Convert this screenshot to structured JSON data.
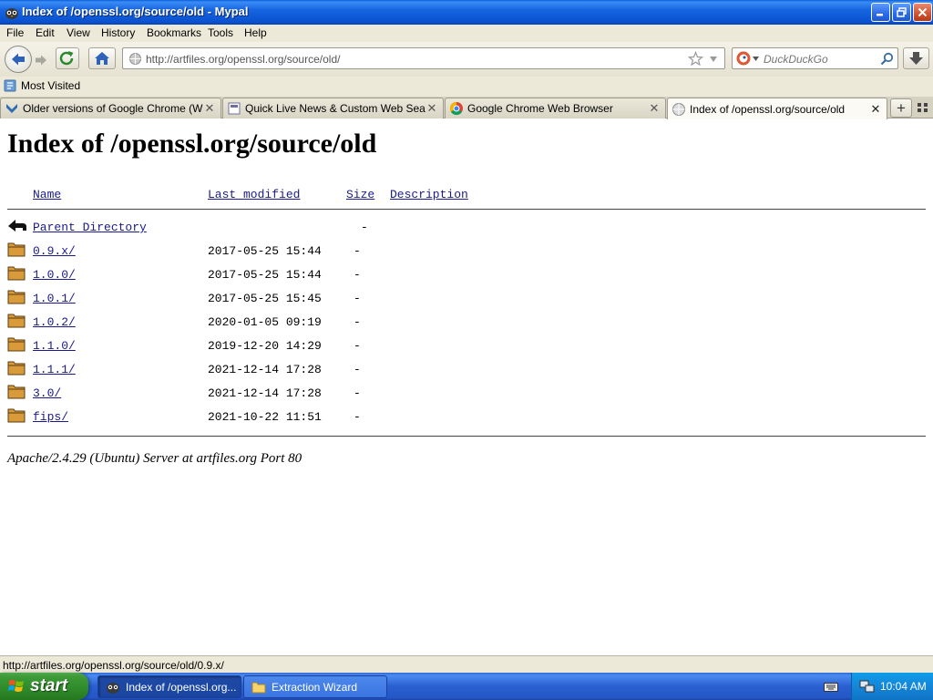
{
  "window": {
    "title": "Index of /openssl.org/source/old - Mypal"
  },
  "menu": {
    "items": [
      "File",
      "Edit",
      "View",
      "History",
      "Bookmarks",
      "Tools",
      "Help"
    ]
  },
  "navbar": {
    "url": "http://artfiles.org/openssl.org/source/old/",
    "search_placeholder": "DuckDuckGo"
  },
  "bookmarks": {
    "most_visited": "Most Visited"
  },
  "tabs": [
    {
      "label": "Older versions of Google Chrome (Wind...",
      "icon": "download-arrow-icon",
      "active": false
    },
    {
      "label": "Quick Live News & Custom Web Search",
      "icon": "page-icon",
      "active": false
    },
    {
      "label": "Google Chrome Web Browser",
      "icon": "chrome-icon",
      "active": false
    },
    {
      "label": "Index of /openssl.org/source/old",
      "icon": "globe-icon",
      "active": true
    }
  ],
  "page": {
    "title": "Index of /openssl.org/source/old",
    "columns": {
      "name": "Name",
      "last_modified": "Last modified",
      "size": "Size",
      "description": "Description"
    },
    "parent": {
      "name": "Parent Directory",
      "size": "-"
    },
    "rows": [
      {
        "name": "0.9.x/",
        "modified": "2017-05-25 15:44",
        "size": "-"
      },
      {
        "name": "1.0.0/",
        "modified": "2017-05-25 15:44",
        "size": "-"
      },
      {
        "name": "1.0.1/",
        "modified": "2017-05-25 15:45",
        "size": "-"
      },
      {
        "name": "1.0.2/",
        "modified": "2020-01-05 09:19",
        "size": "-"
      },
      {
        "name": "1.1.0/",
        "modified": "2019-12-20 14:29",
        "size": "-"
      },
      {
        "name": "1.1.1/",
        "modified": "2021-12-14 17:28",
        "size": "-"
      },
      {
        "name": "3.0/",
        "modified": "2021-12-14 17:28",
        "size": "-"
      },
      {
        "name": "fips/",
        "modified": "2021-10-22 11:51",
        "size": "-"
      }
    ],
    "signature": "Apache/2.4.29 (Ubuntu) Server at artfiles.org Port 80"
  },
  "status": {
    "text": "http://artfiles.org/openssl.org/source/old/0.9.x/"
  },
  "taskbar": {
    "start_label": "start",
    "tasks": [
      {
        "label": "Index of /openssl.org...",
        "active": true,
        "icon": "mypal-icon"
      },
      {
        "label": "Extraction Wizard",
        "active": false,
        "icon": "folder-icon"
      }
    ],
    "clock": "10:04 AM"
  },
  "colors": {
    "link": "#1a1a8c",
    "titlebar": "#0a51cf",
    "taskbar": "#2458c8",
    "start_button": "#2f8a2a"
  }
}
